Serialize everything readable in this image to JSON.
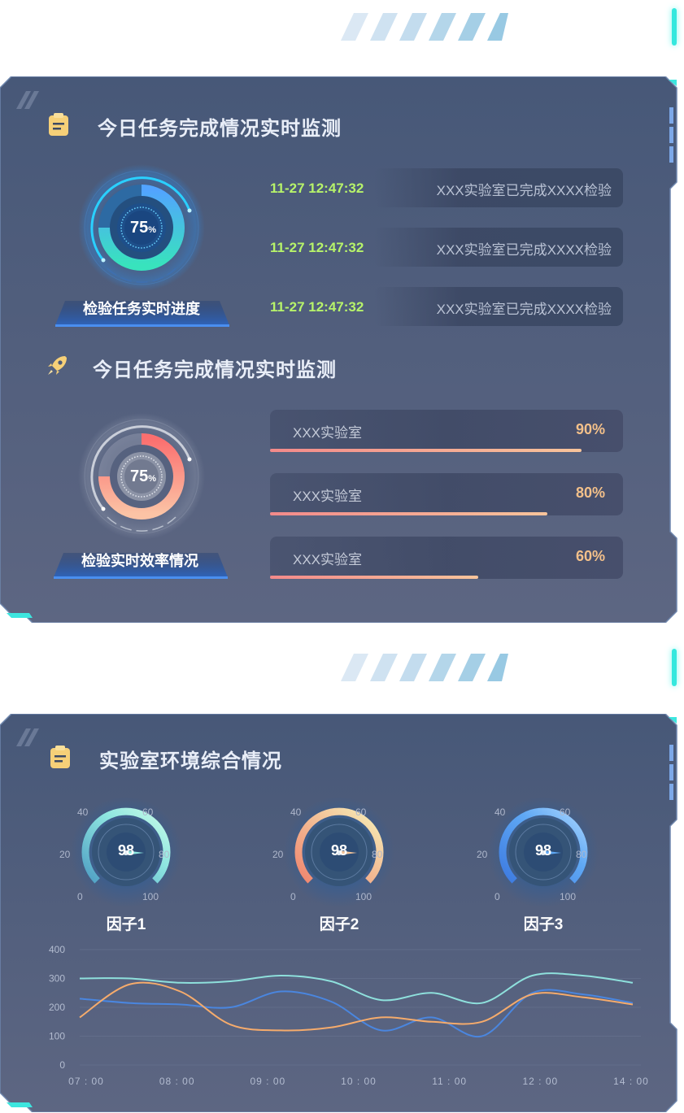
{
  "panel1": {
    "section1_title": "今日任务完成情况实时监测",
    "progress_gauge": {
      "value": "75",
      "unit": "%",
      "fraction": 0.75,
      "label": "检验任务实时进度"
    },
    "events": [
      {
        "time": "11-27 12:47:32",
        "text": "XXX实验室已完成XXXX检验"
      },
      {
        "time": "11-27 12:47:32",
        "text": "XXX实验室已完成XXXX检验"
      },
      {
        "time": "11-27 12:47:32",
        "text": "XXX实验室已完成XXXX检验"
      }
    ],
    "section2_title": "今日任务完成情况实时监测",
    "efficiency_gauge": {
      "value": "75",
      "unit": "%",
      "fraction": 0.75,
      "label": "检验实时效率情况"
    },
    "labs": [
      {
        "name": "XXX实验室",
        "percent": "90%",
        "fraction": 0.9
      },
      {
        "name": "XXX实验室",
        "percent": "80%",
        "fraction": 0.8
      },
      {
        "name": "XXX实验室",
        "percent": "60%",
        "fraction": 0.6
      }
    ]
  },
  "panel2": {
    "title": "实验室环境综合情况",
    "gauge_ticks": [
      "0",
      "20",
      "40",
      "60",
      "80",
      "100"
    ],
    "factors": [
      {
        "name": "因子1",
        "value": "98",
        "colors": [
          "#4f9fc4",
          "#8ee6e0",
          "#c9fbe8"
        ]
      },
      {
        "name": "因子2",
        "value": "98",
        "colors": [
          "#f0856e",
          "#f3c49a",
          "#f6f0b8"
        ]
      },
      {
        "name": "因子3",
        "value": "98",
        "colors": [
          "#3d7ae0",
          "#5fa8f4",
          "#a9d5ff"
        ]
      }
    ]
  },
  "chart_data": {
    "type": "line",
    "x": [
      "07:00",
      "08:00",
      "09:00",
      "10:00",
      "11:00",
      "12:00",
      "14:00"
    ],
    "y_ticks": [
      "0",
      "100",
      "200",
      "300",
      "400"
    ],
    "ylim": [
      0,
      400
    ],
    "series": [
      {
        "color": "#8ee0dc",
        "values": [
          300,
          300,
          285,
          290,
          310,
          290,
          225,
          250,
          215,
          310,
          310,
          285
        ]
      },
      {
        "color": "#4a86df",
        "values": [
          230,
          215,
          210,
          200,
          255,
          220,
          120,
          165,
          100,
          250,
          245,
          215
        ]
      },
      {
        "color": "#f5ab6c",
        "values": [
          165,
          280,
          255,
          140,
          120,
          130,
          165,
          150,
          150,
          245,
          235,
          210
        ]
      }
    ]
  }
}
